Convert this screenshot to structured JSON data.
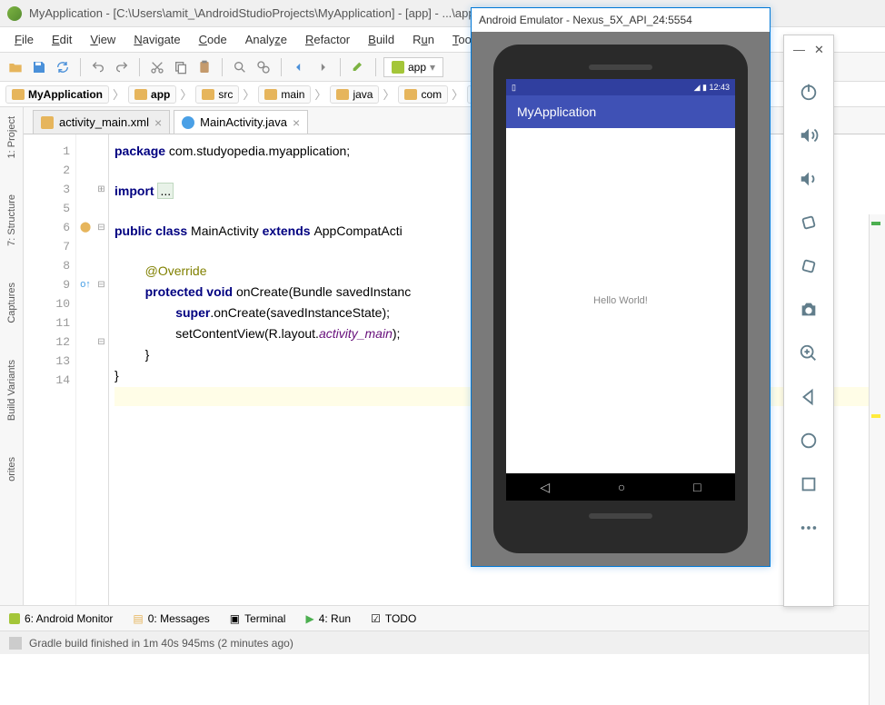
{
  "window": {
    "title": "MyApplication - [C:\\Users\\amit_\\AndroidStudioProjects\\MyApplication] - [app] - ...\\app\\src\\main\\java\\com\\studyopedia\\myapplication\\Mai"
  },
  "menu": [
    "File",
    "Edit",
    "View",
    "Navigate",
    "Code",
    "Analyze",
    "Refactor",
    "Build",
    "Run",
    "Tool"
  ],
  "toolbar": {
    "run_target": "app"
  },
  "breadcrumb": [
    "MyApplication",
    "app",
    "src",
    "main",
    "java",
    "com",
    "s"
  ],
  "tabs": [
    {
      "label": "activity_main.xml",
      "active": false,
      "iconColor": "#e6b55c"
    },
    {
      "label": "MainActivity.java",
      "active": true,
      "iconColor": "#4aa0e6"
    }
  ],
  "code": {
    "lines": [
      1,
      2,
      3,
      5,
      6,
      7,
      8,
      9,
      10,
      11,
      12,
      13,
      14
    ],
    "package_kw": "package",
    "package_val": " com.studyopedia.myapplication;",
    "import_kw": "import ",
    "import_val": "...",
    "class_decl_1": "public class ",
    "class_name": "MainActivity ",
    "extends_kw": "extends ",
    "super_cls": "AppCompatActi",
    "ann": "@Override",
    "meth_1": "protected void ",
    "meth_name": "onCreate",
    "meth_sig": "(Bundle savedInstanc",
    "super_call": "super",
    "super_call2": ".onCreate(savedInstanceState);",
    "set_content_1": "setContentView(R.layout.",
    "set_content_2": "activity_main",
    "set_content_3": ");",
    "brace1": "}",
    "brace2": "}"
  },
  "left_tabs": [
    "1: Project",
    "7: Structure",
    "Captures",
    "Build Variants",
    "orites"
  ],
  "bottom": [
    {
      "icon": "android",
      "label": "6: Android Monitor",
      "iconColor": "#a4c639"
    },
    {
      "icon": "msg",
      "label": "0: Messages",
      "iconColor": "#e6b55c"
    },
    {
      "icon": "term",
      "label": "Terminal",
      "iconColor": "#555"
    },
    {
      "icon": "run",
      "label": "4: Run",
      "iconColor": "#4caf50"
    },
    {
      "icon": "todo",
      "label": "TODO",
      "iconColor": "#999"
    }
  ],
  "status": "Gradle build finished in 1m 40s 945ms (2 minutes ago)",
  "emulator": {
    "title": "Android Emulator - Nexus_5X_API_24:5554",
    "time": "12:43",
    "app_name": "MyApplication",
    "content": "Hello World!"
  },
  "emu_icons": [
    "power",
    "vol-up",
    "vol-down",
    "rotate-left",
    "rotate-right",
    "camera",
    "zoom",
    "back",
    "home",
    "overview",
    "more"
  ]
}
